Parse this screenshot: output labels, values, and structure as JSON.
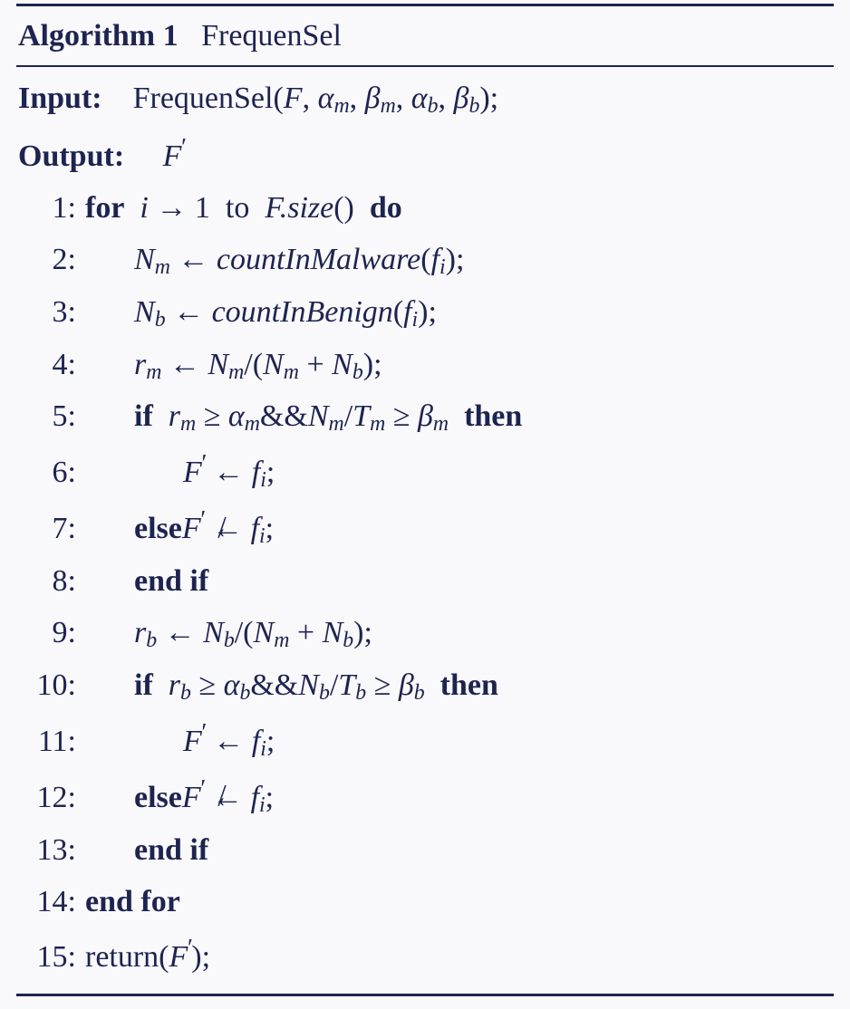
{
  "header": {
    "algo_label": "Algorithm 1",
    "algo_name": "FrequenSel"
  },
  "io": {
    "input_label": "Input:",
    "input_text_pre": "FrequenSel(",
    "input_args": "F, α_m, β_m, α_b, β_b",
    "input_text_post": ");",
    "output_label": "Output:",
    "output_var": "F′"
  },
  "lines": [
    {
      "n": "1:",
      "kw_for": "for",
      "text_a": "i → 1",
      "kw_to": "to",
      "text_b": "F.size()",
      "kw_do": "do"
    },
    {
      "n": "2:",
      "lhs": "N_m",
      "arrow": "←",
      "rhs_fn": "countInMalware",
      "rhs_arg": "f_i",
      "tail": ";"
    },
    {
      "n": "3:",
      "lhs": "N_b",
      "arrow": "←",
      "rhs_fn": "countInBenign",
      "rhs_arg": "f_i",
      "tail": ";"
    },
    {
      "n": "4:",
      "lhs": "r_m",
      "arrow": "←",
      "rhs_expr": "N_m/(N_m + N_b)",
      "tail": ";"
    },
    {
      "n": "5:",
      "kw_if": "if",
      "cond": "r_m ≥ α_m && N_m/T_m ≥ β_m",
      "kw_then": "then"
    },
    {
      "n": "6:",
      "lhs": "F′",
      "arrow": "←",
      "rhs": "f_i",
      "tail": ";"
    },
    {
      "n": "7:",
      "kw_else": "else",
      "else_lhs": "F′",
      "else_op": "notleft",
      "else_rhs": "f_i",
      "tail": ";"
    },
    {
      "n": "8:",
      "kw_endif": "end if"
    },
    {
      "n": "9:",
      "lhs": "r_b",
      "arrow": "←",
      "rhs_expr": "N_b/(N_m + N_b)",
      "tail": ";"
    },
    {
      "n": "10:",
      "kw_if": "if",
      "cond": "r_b ≥ α_b && N_b/T_b ≥ β_b",
      "kw_then": "then"
    },
    {
      "n": "11:",
      "lhs": "F′",
      "arrow": "←",
      "rhs": "f_i",
      "tail": ";"
    },
    {
      "n": "12:",
      "kw_else": "else",
      "else_lhs": "F′",
      "else_op": "notleft",
      "else_rhs": "f_i",
      "tail": ";"
    },
    {
      "n": "13:",
      "kw_endif": "end if"
    },
    {
      "n": "14:",
      "kw_endfor": "end for"
    },
    {
      "n": "15:",
      "ret_pre": "return(",
      "ret_var": "F′",
      "ret_post": ");"
    }
  ]
}
